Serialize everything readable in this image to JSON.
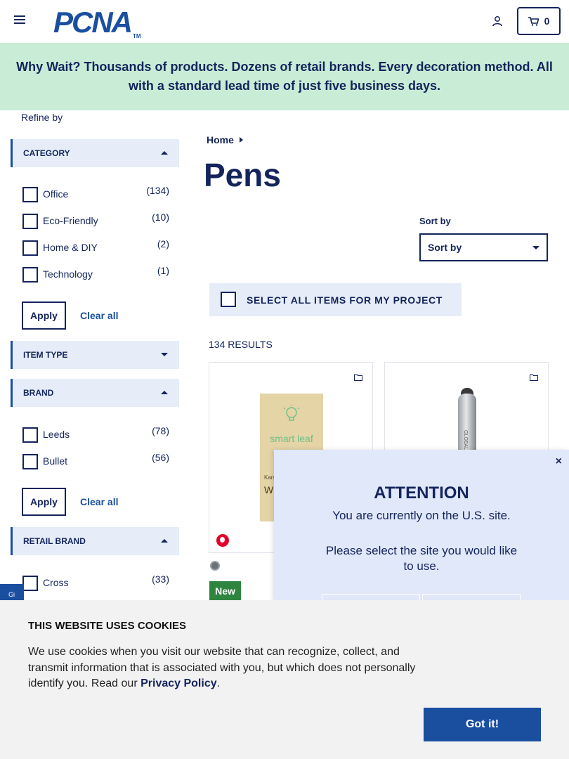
{
  "header": {
    "logo_text": "PCNA",
    "logo_tm": "TM",
    "cart_count": "0"
  },
  "banner": {
    "text": "Why Wait? Thousands of products. Dozens of retail brands. Every decoration method. All with a standard lead time of just five business days."
  },
  "sidebar": {
    "refine_label": "Refine by",
    "facets": {
      "category": {
        "title": "CATEGORY",
        "options": [
          {
            "label": "Office",
            "count": "(134)"
          },
          {
            "label": "Eco-Friendly",
            "count": "(10)"
          },
          {
            "label": "Home & DIY",
            "count": "(2)"
          },
          {
            "label": "Technology",
            "count": "(1)"
          }
        ],
        "apply_label": "Apply",
        "clear_label": "Clear all"
      },
      "item_type": {
        "title": "ITEM TYPE"
      },
      "brand": {
        "title": "BRAND",
        "options": [
          {
            "label": "Leeds",
            "count": "(78)"
          },
          {
            "label": "Bullet",
            "count": "(56)"
          }
        ],
        "apply_label": "Apply",
        "clear_label": "Clear all"
      },
      "retail_brand": {
        "title": "RETAIL BRAND",
        "options": [
          {
            "label": "Cross",
            "count": "(33)"
          }
        ]
      }
    },
    "side_tab_text": "Gi"
  },
  "main": {
    "breadcrumb_home": "Home",
    "title": "Pens",
    "sort_label": "Sort by",
    "sort_value": "Sort by",
    "select_all_label": "SELECT ALL ITEMS FOR MY PROJECT",
    "results_label": "134 RESULTS",
    "products": [
      {
        "pack_brand": "smart leaf",
        "pack_small": "Karst",
        "pack_name": "W Pe",
        "badge": "New"
      },
      {
        "pen_print": "GLOBAL RELIEF"
      }
    ]
  },
  "modal": {
    "close_label": "×",
    "title": "ATTENTION",
    "line1": "You are currently on the U.S. site.",
    "line2": "Please select the site you would like to use."
  },
  "cookie": {
    "title": "THIS WEBSITE USES COOKIES",
    "text_before": "We use cookies when you visit our website that can recognize, collect, and transmit information that is associated with you, but which does not personally identify you. Read our ",
    "link_label": "Privacy Policy",
    "text_after": ".",
    "button_label": "Got it!"
  },
  "colors": {
    "navy": "#14245c",
    "brand_blue": "#1a4fa0",
    "banner_green": "#c8ecd5",
    "facet_bg": "#e6edf9",
    "new_green": "#2e8540"
  }
}
